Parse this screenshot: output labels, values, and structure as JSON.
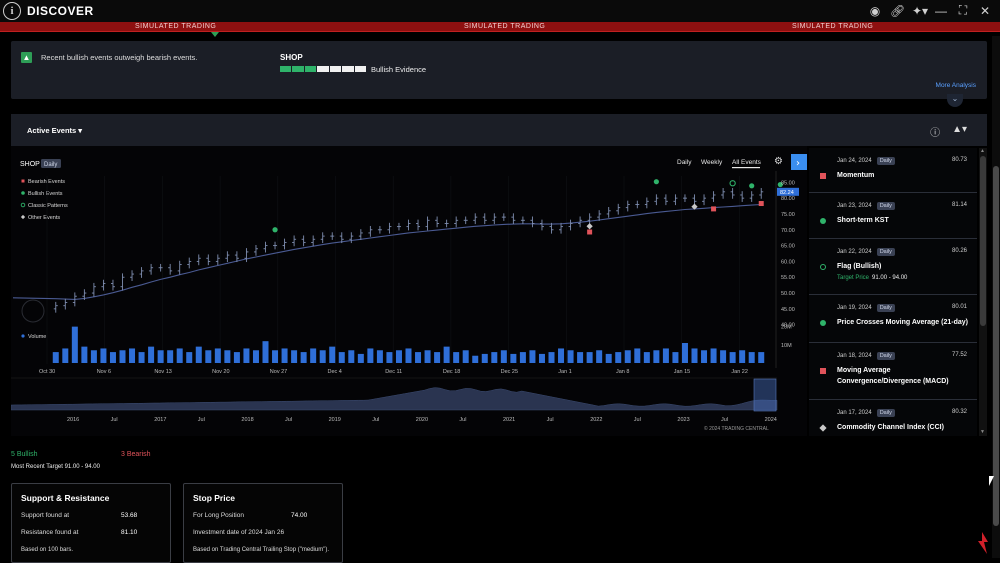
{
  "app": {
    "title": "DISCOVER",
    "info_icon": "info-circle-icon"
  },
  "window_icons": [
    "search-person-icon",
    "link-icon",
    "pin-icon",
    "minimize-icon",
    "restore-icon",
    "close-icon"
  ],
  "simulated_label": "SIMULATED TRADING",
  "summary": {
    "message": "Recent bullish events outweigh bearish events.",
    "symbol": "SHOP",
    "evidence_label": "Bullish Evidence",
    "evidence_segments": [
      "green",
      "green",
      "green",
      "white",
      "white",
      "white",
      "white"
    ],
    "more_link": "More Analysis"
  },
  "panel": {
    "filter_label": "Active Events"
  },
  "chart": {
    "symbol": "SHOP",
    "interval_badge": "Daily",
    "tabs": [
      "Daily",
      "Weekly",
      "All Events"
    ],
    "active_tab": "All Events",
    "legend": [
      {
        "label": "Bearish Events",
        "color": "#e0535a"
      },
      {
        "label": "Bullish Events",
        "color": "#2fb36a"
      },
      {
        "label": "Classic Patterns",
        "color": "#2fb36a"
      },
      {
        "label": "Other Events",
        "color": "#c8c8c8"
      }
    ],
    "volume_label": "Volume",
    "copyright": "© 2024 TRADING CENTRAL",
    "last_price_tag": "82.24",
    "colors": {
      "bar": "#7f8eb0",
      "ma": "#4a5a92",
      "volume": "#2f6fd8"
    }
  },
  "chart_data": {
    "type": "ohlc",
    "price_axis_ticks": [
      "85.00",
      "80.00",
      "75.00",
      "70.00",
      "65.00",
      "60.00",
      "55.00",
      "50.00",
      "45.00",
      "40.00"
    ],
    "volume_axis_ticks": [
      "20M",
      "10M"
    ],
    "x_tick_labels": [
      "Oct 30",
      "Nov 6",
      "Nov 13",
      "Nov 20",
      "Nov 27",
      "Dec 4",
      "Dec 11",
      "Dec 18",
      "Dec 25",
      "Jan 1",
      "Jan 8",
      "Jan 15",
      "Jan 22"
    ],
    "navigator_ticks": [
      "2016",
      "Jul",
      "2017",
      "Jul",
      "2018",
      "Jul",
      "2019",
      "Jul",
      "2020",
      "Jul",
      "2021",
      "Jul",
      "2022",
      "Jul",
      "2023",
      "Jul",
      "2024"
    ],
    "ylim": [
      38,
      87
    ],
    "close": [
      46,
      47,
      49,
      50,
      52,
      53,
      52,
      55,
      56,
      57,
      58,
      58,
      57,
      59,
      60,
      61,
      60,
      61,
      62,
      61,
      63,
      64,
      65,
      65,
      66,
      67,
      66,
      67,
      68,
      68,
      67,
      68,
      69,
      70,
      70,
      71,
      71,
      72,
      71,
      73,
      72,
      72,
      73,
      73,
      74,
      73,
      74,
      74,
      73,
      73,
      72,
      71,
      70,
      71,
      72,
      73,
      74,
      75,
      76,
      77,
      78,
      78,
      79,
      80,
      79,
      80,
      80,
      79,
      80,
      81,
      82,
      81,
      80,
      81,
      82
    ],
    "ma": [
      48.2,
      48.1,
      48.0,
      48.3,
      48.8,
      49.4,
      50.1,
      50.9,
      51.8,
      52.6,
      53.5,
      54.3,
      55.0,
      55.8,
      56.5,
      57.3,
      58.0,
      58.7,
      59.4,
      60.1,
      60.8,
      61.4,
      62.0,
      62.6,
      63.2,
      63.8,
      64.3,
      64.8,
      65.3,
      65.8,
      66.2,
      66.6,
      67.0,
      67.4,
      67.8,
      68.2,
      68.6,
      69.0,
      69.3,
      69.6,
      69.9,
      70.2,
      70.5,
      70.8,
      71.1,
      71.3,
      71.5,
      71.7,
      71.8,
      71.9,
      71.9,
      71.8,
      71.8,
      71.9,
      72.1,
      72.4,
      72.7,
      73.1,
      73.5,
      73.9,
      74.3,
      74.7,
      75.1,
      75.5,
      75.8,
      76.1,
      76.4,
      76.6,
      76.8,
      77.0,
      77.2,
      77.4,
      77.6,
      77.8,
      78.0
    ],
    "volume": [
      6,
      8,
      20,
      9,
      7,
      8,
      6,
      7,
      8,
      6,
      9,
      7,
      7,
      8,
      6,
      9,
      7,
      8,
      7,
      6,
      8,
      7,
      12,
      7,
      8,
      7,
      6,
      8,
      7,
      9,
      6,
      7,
      5,
      8,
      7,
      6,
      7,
      8,
      6,
      7,
      6,
      9,
      6,
      7,
      4,
      5,
      6,
      7,
      5,
      6,
      7,
      5,
      6,
      8,
      7,
      6,
      6,
      7,
      5,
      6,
      7,
      8,
      6,
      7,
      8,
      6,
      11,
      8,
      7,
      8,
      7,
      6,
      7,
      6,
      6
    ],
    "events": [
      {
        "type": "bullish",
        "bar": 23,
        "price": 70.0
      },
      {
        "type": "bearish",
        "bar": 56,
        "price": 69.3
      },
      {
        "type": "other",
        "bar": 56,
        "price": 71.1
      },
      {
        "type": "bullish",
        "bar": 63,
        "price": 85.2
      },
      {
        "type": "other",
        "bar": 67,
        "price": 77.3
      },
      {
        "type": "bearish",
        "bar": 69,
        "price": 76.6
      },
      {
        "type": "classic",
        "bar": 71,
        "price": 84.7
      },
      {
        "type": "bullish",
        "bar": 73,
        "price": 83.9
      },
      {
        "type": "bearish",
        "bar": 74,
        "price": 78.3
      },
      {
        "type": "bullish",
        "bar": 76,
        "price": 84.3
      }
    ]
  },
  "events_list": [
    {
      "date": "Jan 24, 2024",
      "badge": "Daily",
      "value": "80.73",
      "name": "Momentum",
      "marker": "bearish"
    },
    {
      "date": "Jan 23, 2024",
      "badge": "Daily",
      "value": "81.14",
      "name": "Short-term KST",
      "marker": "bullish"
    },
    {
      "date": "Jan 22, 2024",
      "badge": "Daily",
      "value": "80.26",
      "name": "Flag (Bullish)",
      "marker": "classic",
      "target_label": "Target Price",
      "target_value": "91.00 - 94.00"
    },
    {
      "date": "Jan 19, 2024",
      "badge": "Daily",
      "value": "80.01",
      "name": "Price Crosses Moving Average (21-day)",
      "marker": "bullish"
    },
    {
      "date": "Jan 18, 2024",
      "badge": "Daily",
      "value": "77.52",
      "name": "Moving Average Convergence/Divergence (MACD)",
      "marker": "bearish"
    },
    {
      "date": "Jan 17, 2024",
      "badge": "Daily",
      "value": "80.32",
      "name": "Commodity Channel Index (CCI)",
      "marker": "other"
    }
  ],
  "counts": {
    "bullish": "5 Bullish",
    "bearish": "3 Bearish",
    "most_recent_target": "Most Recent Target 91.00 - 94.00"
  },
  "support_resistance": {
    "title": "Support & Resistance",
    "support_label": "Support found at",
    "support_value": "53.68",
    "resistance_label": "Resistance found at",
    "resistance_value": "81.10",
    "note": "Based on 100 bars."
  },
  "stop_price": {
    "title": "Stop Price",
    "position_label": "For Long Position",
    "position_value": "74.00",
    "investment_label": "Investment date of 2024 Jan 26",
    "note": "Based on Trading Central Trailing Stop (\"medium\")."
  }
}
